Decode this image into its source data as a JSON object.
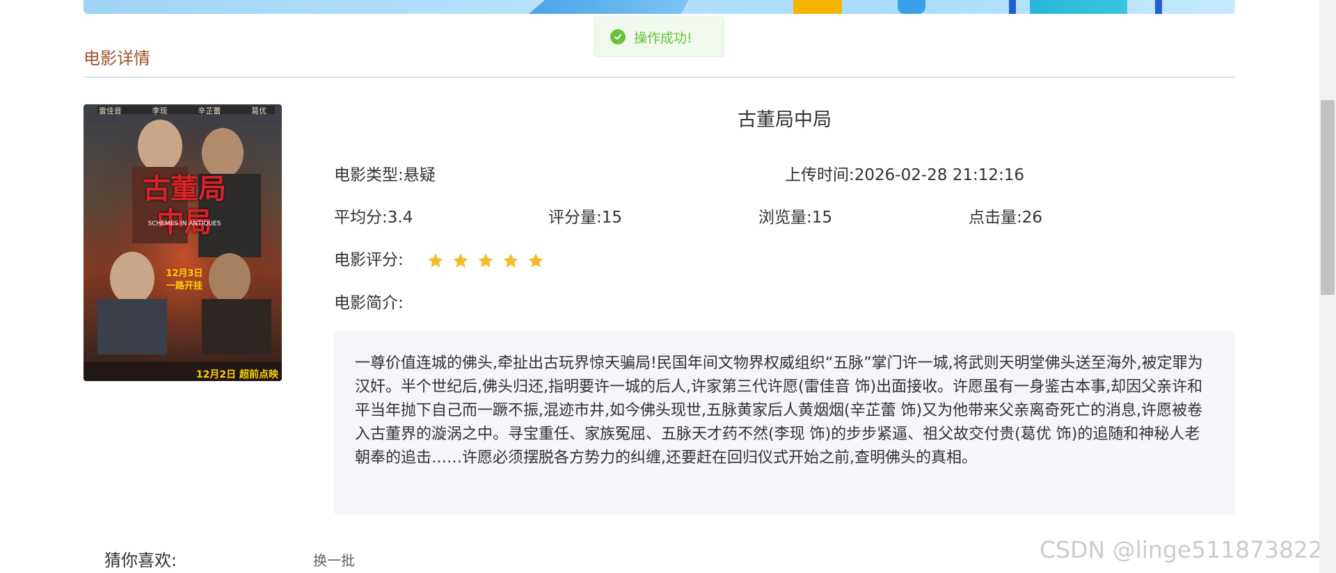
{
  "toast": {
    "message": "操作成功!"
  },
  "section": {
    "title": "电影详情"
  },
  "movie": {
    "title": "古董局中局",
    "genre_label": "电影类型:",
    "genre": "悬疑",
    "upload_label": "上传时间:",
    "upload_time": "2026-02-28 21:12:16",
    "avg_label": "平均分:",
    "avg_score": "3.4",
    "rating_count_label": "评分量:",
    "rating_count": "15",
    "view_label": "浏览量:",
    "view_count": "15",
    "click_label": "点击量:",
    "click_count": "26",
    "rate_label": "电影评分:",
    "star_rating": 5,
    "intro_label": "电影简介:",
    "intro": "一尊价值连城的佛头,牵扯出古玩界惊天骗局!民国年间文物界权威组织“五脉”掌门许一城,将武则天明堂佛头送至海外,被定罪为汉奸。半个世纪后,佛头归还,指明要许一城的后人,许家第三代许愿(雷佳音 饰)出面接收。许愿虽有一身鉴古本事,却因父亲许和平当年抛下自己而一蹶不振,混迹市井,如今佛头现世,五脉黄家后人黄烟烟(辛芷蕾 饰)又为他带来父亲离奇死亡的消息,许愿被卷入古董界的漩涡之中。寻宝重任、家族冤屈、五脉天才药不然(李现 饰)的步步紧逼、祖父故交付贵(葛优 饰)的追随和神秘人老朝奉的追击……许愿必须摆脱各方势力的纠缠,还要赶在回归仪式开始之前,查明佛头的真相。"
  },
  "poster": {
    "cast": [
      "雷佳音",
      "李现",
      "辛芷蕾",
      "葛优"
    ],
    "title_cn": "古董局中局",
    "title_en": "SCHEMES IN ANTIQUES",
    "release": "12月3日 一路开挂",
    "presale": "12月2日 超前点映"
  },
  "guess": {
    "label": "猜你喜欢:",
    "refresh": "换一批"
  },
  "watermark": "CSDN @linge511873822",
  "colors": {
    "accent": "#a0522d",
    "success": "#67c23a",
    "star": "#f7ba2a"
  }
}
